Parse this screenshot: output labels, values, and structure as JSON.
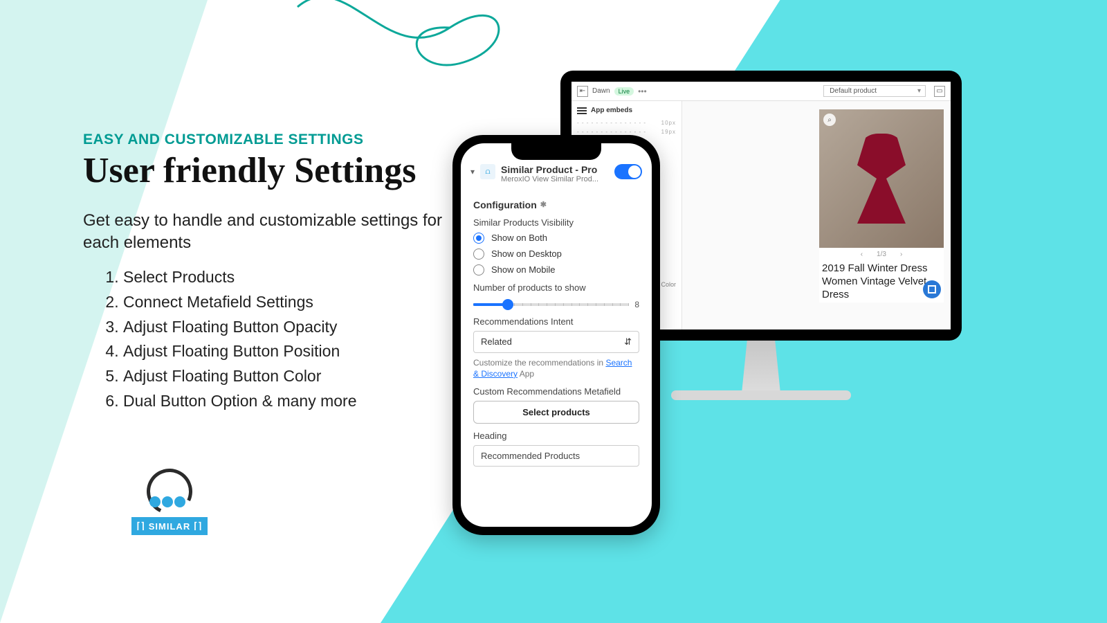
{
  "hero": {
    "eyebrow": "EASY AND CUSTOMIZABLE SETTINGS",
    "headline": "User friendly Settings",
    "lede": "Get easy to handle and customizable settings for each elements",
    "items": [
      "Select Products",
      "Connect Metafield Settings",
      "Adjust Floating Button Opacity",
      "Adjust Floating Button Position",
      "Adjust Floating Button Color",
      "Dual Button Option & many more"
    ]
  },
  "logo": {
    "word": "SIMILAR"
  },
  "monitor": {
    "theme": "Dawn",
    "live": "Live",
    "selector": "Default product",
    "side_label": "App embeds",
    "ruler1": "10px",
    "ruler2": "19px",
    "side_color": "Color",
    "pager": "1/3",
    "product_title": "2019 Fall Winter Dress Women Vintage Velvet Dress"
  },
  "phone": {
    "app_title": "Similar Product - Pro",
    "app_sub": "MeroxIO View Similar Prod...",
    "section": "Configuration",
    "vis_label": "Similar Products Visibility",
    "vis_opts": [
      "Show on Both",
      "Show on Desktop",
      "Show on Mobile"
    ],
    "count_label": "Number of products to show",
    "count_value": "8",
    "intent_label": "Recommendations Intent",
    "intent_value": "Related",
    "help_pre": "Customize the recommendations in",
    "help_link": "Search & Discovery",
    "help_post": "App",
    "meta_label": "Custom Recommendations Metafield",
    "select_btn": "Select products",
    "heading_label": "Heading",
    "heading_value": "Recommended Products"
  },
  "colors": {
    "teal": "#5ee2e7",
    "mint": "#d4f4f0",
    "accent": "#1a73ff"
  }
}
